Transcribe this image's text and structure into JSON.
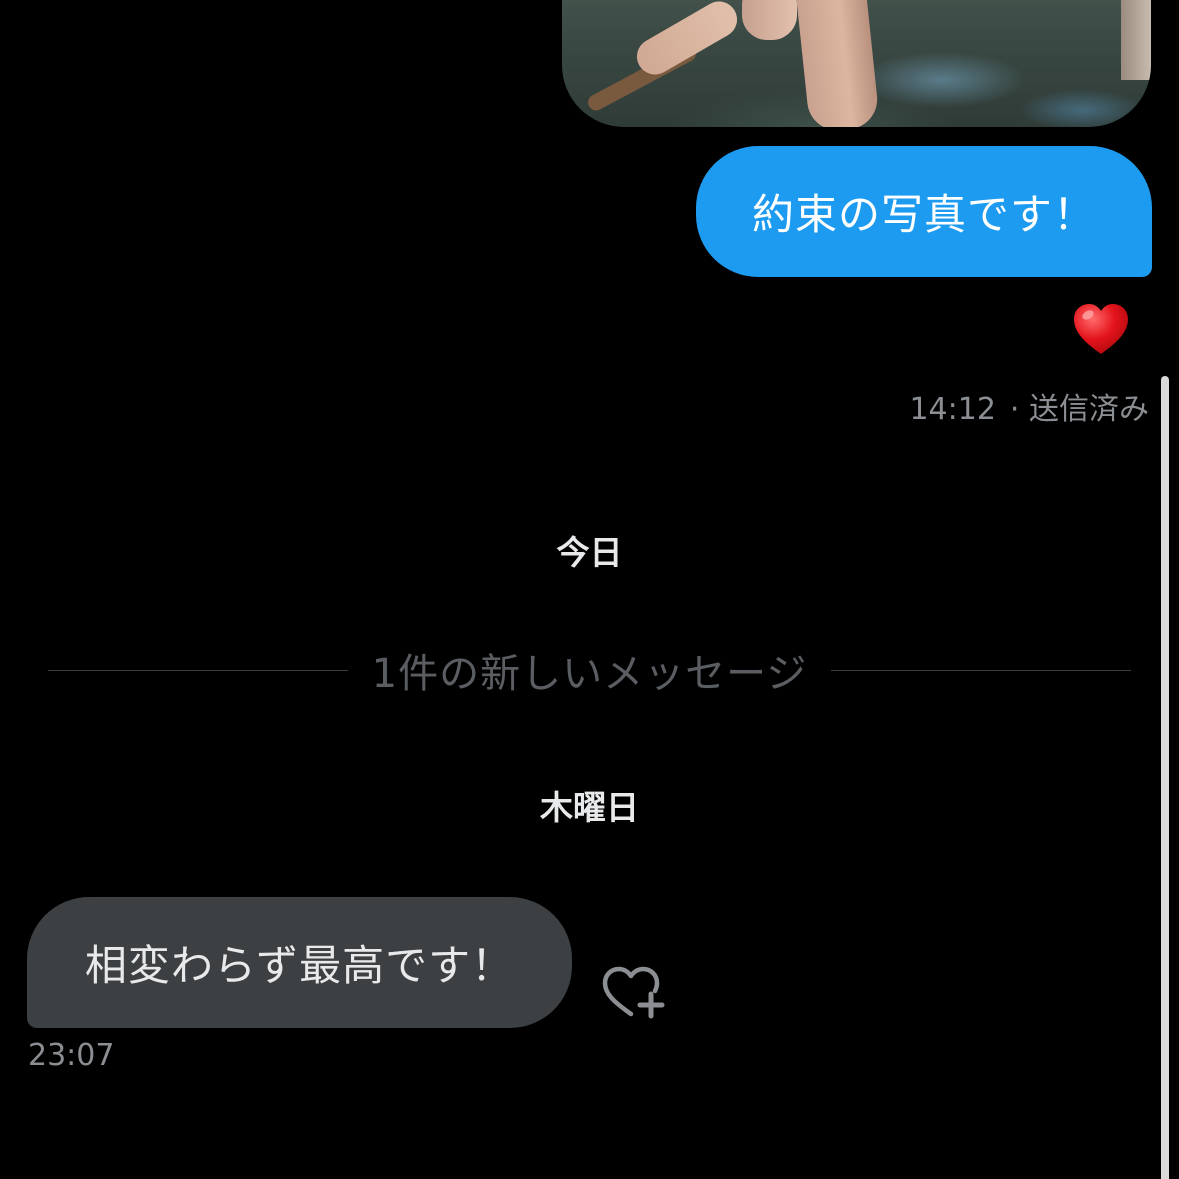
{
  "conversation": {
    "sent_message": {
      "text": "約束の写真です！",
      "reaction": "❤️",
      "time": "14:12",
      "status": "· 送信済み",
      "bubble_color": "#1d9bf0"
    },
    "day_today": "今日",
    "new_messages_divider": "1件の新しいメッセージ",
    "day_thursday": "木曜日",
    "received_message": {
      "text": "相変わらず最高です！",
      "time": "23:07",
      "bubble_color": "#3c4043"
    }
  },
  "icons": {
    "reaction": "heart-emoji",
    "like_add": "heart-plus-icon"
  }
}
